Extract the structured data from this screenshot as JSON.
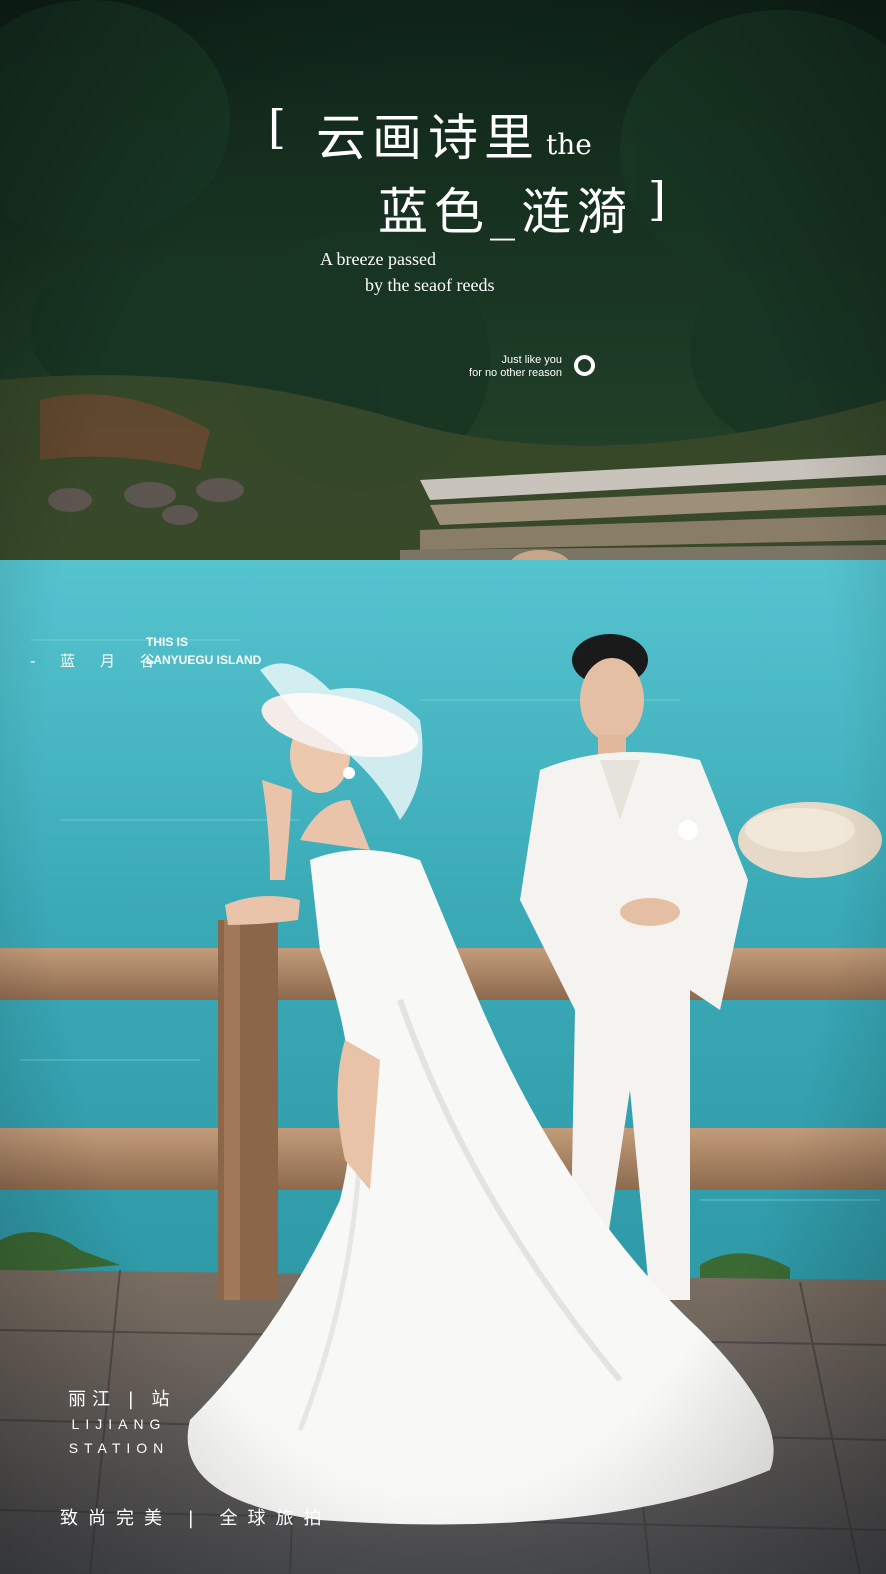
{
  "poster": {
    "title_line1": "云画诗里",
    "title_the": "the",
    "title_line2": "蓝色_涟漪",
    "bracket_open": "[",
    "bracket_close": "]",
    "subtitle_line1": "A breeze passed",
    "subtitle_line2": "by the seaof reeds",
    "tagline_line1": "Just like you",
    "tagline_line2": "for no other reason",
    "location_cn": "- 蓝 月 谷",
    "location_en_line1": "THIS IS",
    "location_en_line2": "LANYUEGU ISLAND",
    "station_cn": "丽江 | 站",
    "station_en_line1": "LIJIANG",
    "station_en_line2": "STATION",
    "slogan": "致尚完美 | 全球旅拍"
  },
  "colors": {
    "forest": "#1d3a26",
    "lake": "#3fb2c0",
    "rail": "#b38b6a",
    "stone": "#6b6f72",
    "dress": "#f7f7f5"
  }
}
